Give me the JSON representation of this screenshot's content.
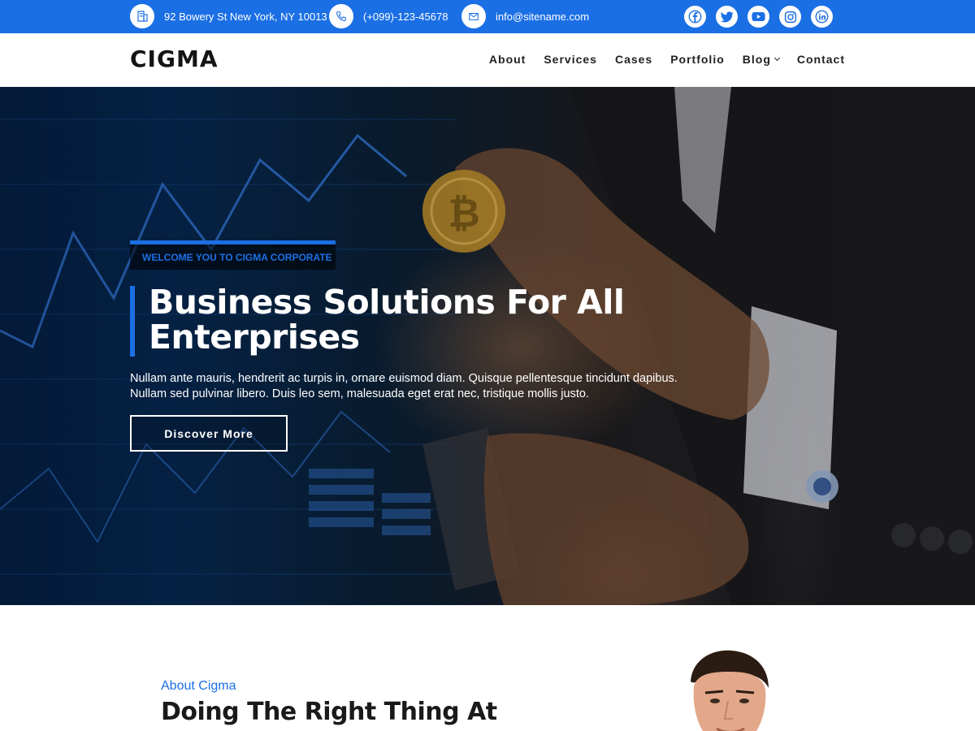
{
  "topbar": {
    "address": "92 Bowery St New York, NY 10013",
    "phone": "(+099)-123-45678",
    "email": "info@sitename.com",
    "socials": [
      "facebook-icon",
      "twitter-icon",
      "youtube-icon",
      "instagram-icon",
      "linkedin-icon"
    ]
  },
  "header": {
    "logo": "CIGMA",
    "nav": [
      "About",
      "Services",
      "Cases",
      "Portfolio",
      "Blog",
      "Contact"
    ]
  },
  "hero": {
    "welcome": "WELCOME YOU TO CIGMA CORPORATE",
    "title_line1": "Business Solutions For All",
    "title_line2": "Enterprises",
    "description_line1": "Nullam ante mauris, hendrerit ac turpis in, ornare euismod diam. Quisque pellentesque tincidunt dapibus.",
    "description_line2": "Nullam sed pulvinar libero. Duis leo sem, malesuada eget erat nec, tristique mollis justo.",
    "button": "Discover More"
  },
  "about": {
    "kicker": "About Cigma",
    "title": "Doing The Right Thing At"
  },
  "colors": {
    "accent": "#1b6fe4",
    "white": "#ffffff",
    "dark": "#1a1a1a"
  }
}
